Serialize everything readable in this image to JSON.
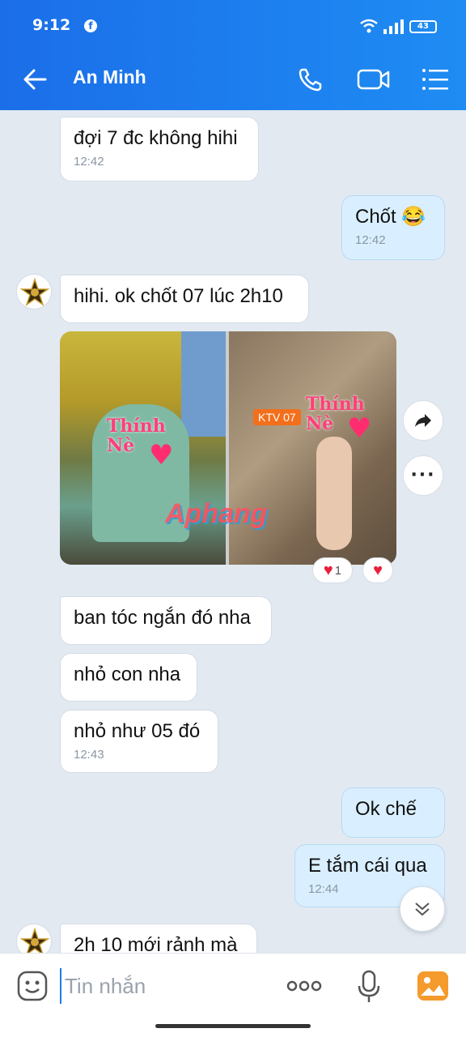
{
  "status": {
    "time": "9:12",
    "battery": "43",
    "fb_icon": "facebook-icon"
  },
  "header": {
    "title": "An Minh",
    "icons": [
      "back-arrow-icon",
      "phone-icon",
      "video-call-icon",
      "menu-list-icon"
    ]
  },
  "messages": [
    {
      "text": "đợi 7 đc không hihi",
      "time": "12:42"
    },
    {
      "text": "Chốt 😂",
      "time": "12:42"
    },
    {
      "text": "hihi. ok chốt 07 lúc 2h10"
    },
    {
      "text": "ban tóc ngắn đó nha"
    },
    {
      "text": "nhỏ con nha"
    },
    {
      "text": "nhỏ như 05 đó",
      "time": "12:43"
    },
    {
      "text": "Ok chế"
    },
    {
      "text": "E tắm cái qua",
      "time": "12:44"
    },
    {
      "text": "2h 10 mới rảnh mà"
    }
  ],
  "photos": {
    "left_sticker": "Thính Nè",
    "right_tag": "KTV 07",
    "right_sticker": "Thính Nè",
    "watermark": "Aphang"
  },
  "reactions": {
    "heart_count": "1"
  },
  "input": {
    "placeholder": "Tin nhắn"
  },
  "colors": {
    "header": "#1e8cf3",
    "my_bubble": "#d9efff",
    "bg": "#e2e9f1"
  }
}
